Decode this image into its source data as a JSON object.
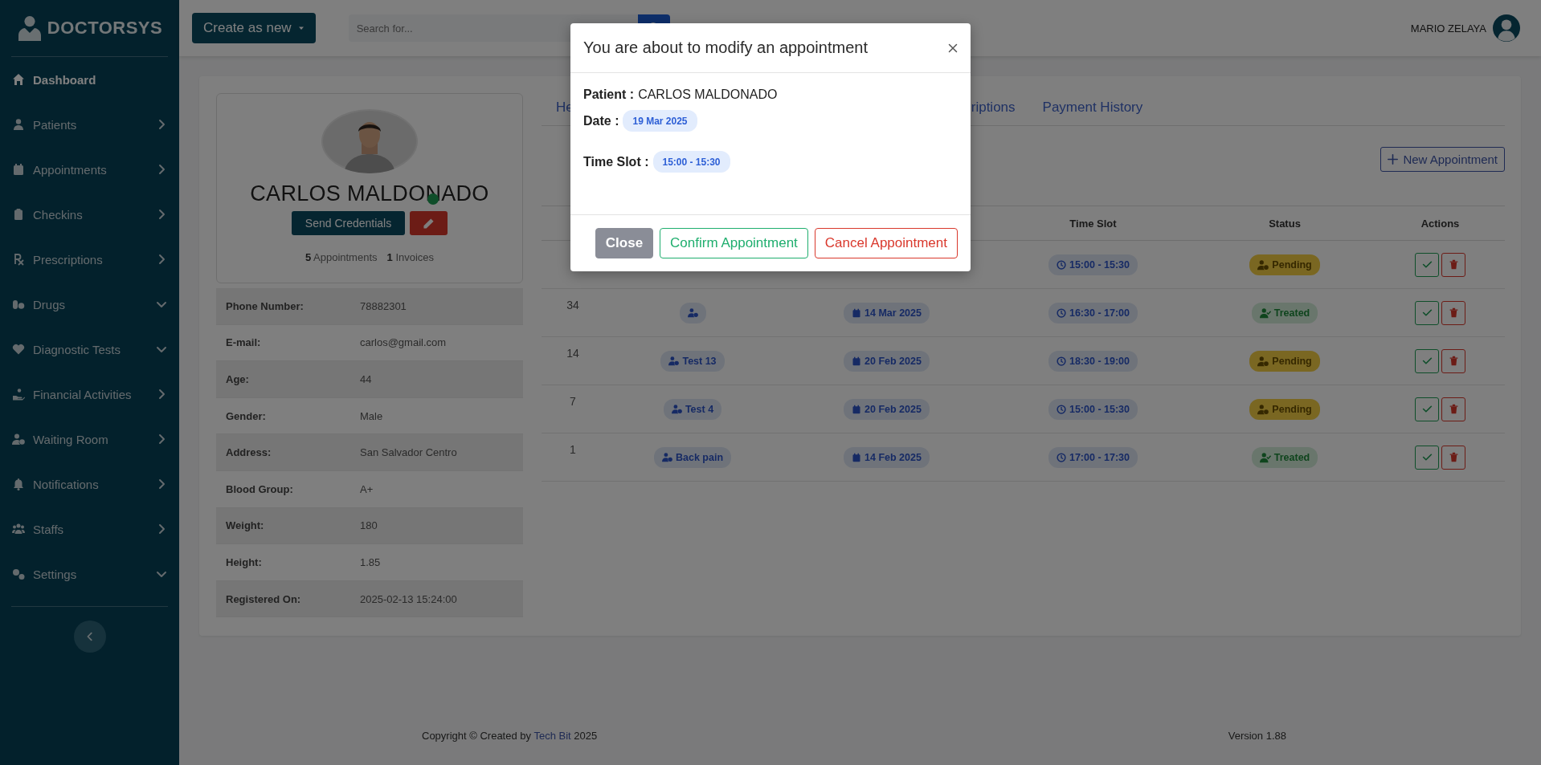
{
  "sidebar": {
    "brand": "DOCTORSYS",
    "items": [
      {
        "label": "Dashboard",
        "selected": true
      },
      {
        "label": "Patients",
        "selected": false,
        "expanded": false
      },
      {
        "label": "Appointments",
        "selected": false,
        "expanded": false
      },
      {
        "label": "Checkins",
        "selected": false,
        "expanded": false
      },
      {
        "label": "Prescriptions",
        "selected": false,
        "expanded": false
      },
      {
        "label": "Drugs",
        "selected": false,
        "expanded": true
      },
      {
        "label": "Diagnostic Tests",
        "selected": false,
        "expanded": true
      },
      {
        "label": "Financial Activities",
        "selected": false,
        "expanded": false
      },
      {
        "label": "Waiting Room",
        "selected": false,
        "expanded": false
      },
      {
        "label": "Notifications",
        "selected": false,
        "expanded": false
      },
      {
        "label": "Staffs",
        "selected": false,
        "expanded": false
      },
      {
        "label": "Settings",
        "selected": false,
        "expanded": true
      }
    ]
  },
  "header": {
    "create_button": "Create as new",
    "search": {
      "placeholder": "Search for..."
    },
    "user_name": "MARIO ZELAYA"
  },
  "patient": {
    "name": "CARLOS MALDONADO",
    "online": true,
    "send_button": "Send Credentials",
    "stats": [
      {
        "count": "5",
        "label": "Appointments"
      },
      {
        "count": "1",
        "label": "Invoices"
      }
    ],
    "details": [
      {
        "label": "Phone Number:",
        "value": "78882301"
      },
      {
        "label": "E-mail:",
        "value": "carlos@gmail.com"
      },
      {
        "label": "Age:",
        "value": "44"
      },
      {
        "label": "Gender:",
        "value": "Male"
      },
      {
        "label": "Address:",
        "value": "San Salvador Centro"
      },
      {
        "label": "Blood Group:",
        "value": "A+"
      },
      {
        "label": "Weight:",
        "value": "180"
      },
      {
        "label": "Height:",
        "value": "1.85"
      },
      {
        "label": "Registered On:",
        "value": "2025-02-13 15:24:00"
      }
    ]
  },
  "tabs": [
    {
      "label": "He",
      "selected": false
    },
    {
      "label": "riptions",
      "selected": false
    },
    {
      "label": "Payment History",
      "selected": false
    }
  ],
  "new_appointment_button": "New Appointment",
  "table": {
    "columns": [
      "Time Slot",
      "Status",
      "Actions"
    ],
    "rows": [
      {
        "time": "15:00 - 15:30",
        "status": {
          "label": "Pending",
          "kind": "pending"
        }
      },
      {
        "id": "34",
        "reason": {
          "kind": "icon"
        },
        "date": "14 Mar 2025",
        "time": "16:30 - 17:00",
        "status": {
          "label": "Treated",
          "kind": "treated"
        }
      },
      {
        "id": "14",
        "reason": {
          "kind": "labeled",
          "label": "Test 13"
        },
        "date": "20 Feb 2025",
        "time": "18:30 - 19:00",
        "status": {
          "label": "Pending",
          "kind": "pending"
        }
      },
      {
        "id": "7",
        "reason": {
          "kind": "labeled",
          "label": "Test 4"
        },
        "date": "20 Feb 2025",
        "time": "15:00 - 15:30",
        "status": {
          "label": "Pending",
          "kind": "pending"
        }
      },
      {
        "id": "1",
        "reason": {
          "kind": "labeled",
          "label": "Back pain"
        },
        "date": "14 Feb 2025",
        "time": "17:00 - 17:30",
        "status": {
          "label": "Treated",
          "kind": "treated"
        }
      }
    ]
  },
  "footer": {
    "prefix": "Copyright © Created by",
    "link": "Tech Bit",
    "suffix": "2025",
    "version": "Version 1.88"
  },
  "modal": {
    "title": "You are about to modify an appointment",
    "patient_label": "Patient :",
    "patient_value": "CARLOS MALDONADO",
    "date_label": "Date :",
    "date": "19 Mar 2025",
    "time_label": "Time Slot :",
    "time": "15:00 - 15:30",
    "buttons": [
      {
        "label": "Close",
        "kind": "secondary"
      },
      {
        "label": "Confirm Appointment",
        "kind": "success"
      },
      {
        "label": "Cancel Appointment",
        "kind": "danger"
      }
    ]
  }
}
